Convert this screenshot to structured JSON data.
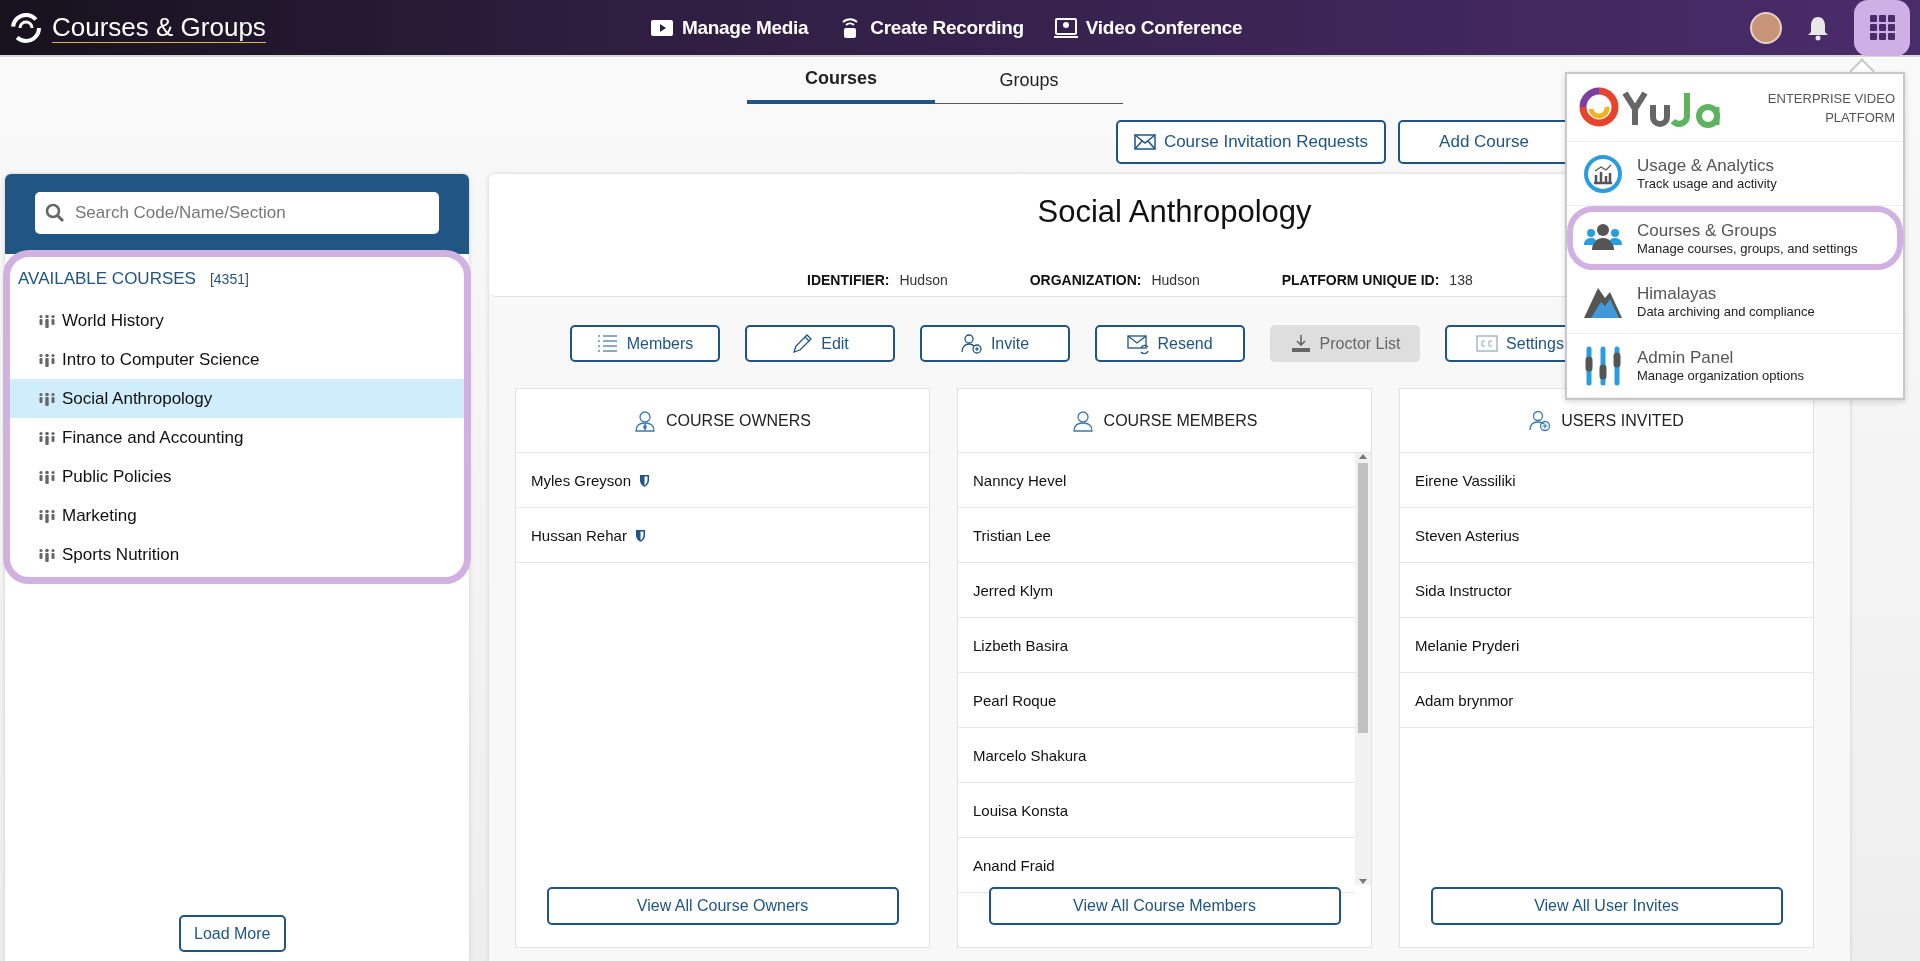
{
  "topbar": {
    "title": "Courses & Groups",
    "nav": [
      {
        "label": "Manage Media"
      },
      {
        "label": "Create Recording"
      },
      {
        "label": "Video Conference"
      }
    ],
    "apps_open": true
  },
  "tabs": [
    {
      "label": "Courses",
      "selected": true
    },
    {
      "label": "Groups",
      "selected": false
    }
  ],
  "actions": [
    "Course Invitation Requests",
    "Add Course"
  ],
  "sidebar": {
    "search_placeholder": "Search Code/Name/Section",
    "heading": "AVAILABLE COURSES",
    "count": "[4351]",
    "load_more": "Load More",
    "items": [
      {
        "label": "World History",
        "selected": false
      },
      {
        "label": "Intro to Computer Science",
        "selected": false
      },
      {
        "label": "Social Anthropology",
        "selected": true
      },
      {
        "label": "Finance and Accounting",
        "selected": false
      },
      {
        "label": "Public Policies",
        "selected": false
      },
      {
        "label": "Marketing",
        "selected": false
      },
      {
        "label": "Sports Nutrition",
        "selected": false
      }
    ]
  },
  "course": {
    "title": "Social Anthropology",
    "info": [
      {
        "label": "IDENTIFIER:",
        "value": "Hudson"
      },
      {
        "label": "ORGANIZATION:",
        "value": "Hudson"
      },
      {
        "label": "PLATFORM UNIQUE ID:",
        "value": "138"
      }
    ],
    "buttons": [
      {
        "label": "Members",
        "disabled": false
      },
      {
        "label": "Edit",
        "disabled": false
      },
      {
        "label": "Invite",
        "disabled": false
      },
      {
        "label": "Resend",
        "disabled": false
      },
      {
        "label": "Proctor List",
        "disabled": true
      },
      {
        "label": "Settings",
        "disabled": false
      }
    ]
  },
  "columns": [
    {
      "title": "COURSE OWNERS",
      "kind": "owners",
      "rows": [
        "Myles Greyson",
        "Hussan Rehar"
      ],
      "button": "View All Course Owners"
    },
    {
      "title": "COURSE MEMBERS",
      "kind": "members",
      "rows": [
        "Nanncy Hevel",
        "Tristian Lee",
        "Jerred Klym",
        "Lizbeth Basira",
        "Pearl Roque",
        "Marcelo Shakura",
        "Louisa Konsta",
        "Anand Fraid"
      ],
      "button": "View All Course Members"
    },
    {
      "title": "USERS INVITED",
      "kind": "invited",
      "rows": [
        "Eirene Vassiliki",
        "Steven Asterius",
        "Sida Instructor",
        "Melanie Pryderi",
        "Adam brynmor"
      ],
      "button": "View All User Invites"
    }
  ],
  "apps_menu": {
    "tagline": "ENTERPRISE VIDEO PLATFORM",
    "items": [
      {
        "title": "Usage & Analytics",
        "subtitle": "Track usage and activity",
        "selected": false
      },
      {
        "title": "Courses & Groups",
        "subtitle": "Manage courses, groups, and settings",
        "selected": true
      },
      {
        "title": "Himalayas",
        "subtitle": "Data archiving and compliance",
        "selected": false
      },
      {
        "title": "Admin Panel",
        "subtitle": "Manage organization options",
        "selected": false
      }
    ]
  }
}
